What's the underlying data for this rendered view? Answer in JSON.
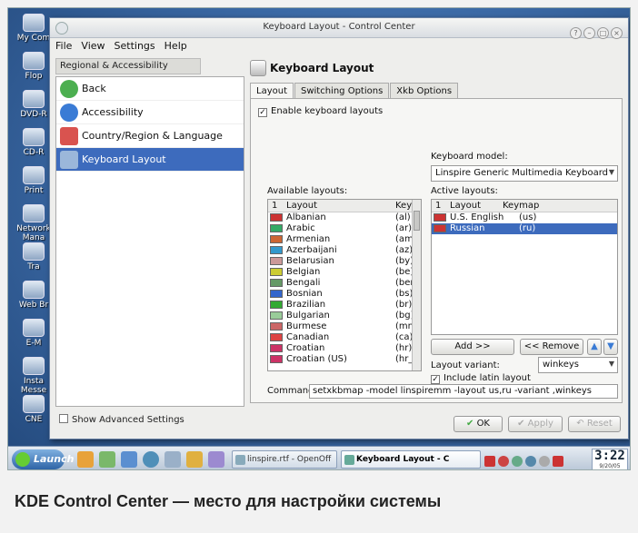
{
  "desktop": {
    "icons": [
      "My Com",
      "Flop",
      "DVD-R",
      "CD-R",
      "Print",
      "Network Mana",
      "Tra",
      "Web Br",
      "E-M",
      "Insta Messe",
      "CNE"
    ]
  },
  "window": {
    "title": "Keyboard Layout - Control Center",
    "menu": [
      "File",
      "View",
      "Settings",
      "Help"
    ]
  },
  "sidebar": {
    "header": "Regional & Accessibility",
    "items": [
      {
        "label": "Back",
        "color": "#4caf50"
      },
      {
        "label": "Accessibility",
        "color": "#3a7bd5"
      },
      {
        "label": "Country/Region & Language",
        "color": "#d9534f"
      },
      {
        "label": "Keyboard Layout",
        "color": "#9bb7da"
      }
    ],
    "advanced": "Show Advanced Settings"
  },
  "panel": {
    "title": "Keyboard Layout",
    "tabs": [
      "Layout",
      "Switching Options",
      "Xkb Options"
    ],
    "enable_label": "Enable keyboard layouts",
    "model_label": "Keyboard model:",
    "model_value": "Linspire Generic Multimedia Keyboard",
    "available_label": "Available layouts:",
    "active_label": "Active layouts:",
    "available_cols": [
      "1",
      "Layout",
      "Keyr"
    ],
    "active_cols": [
      "1",
      "Layout",
      "Keymap"
    ],
    "available": [
      {
        "name": "Albanian",
        "map": "(al)",
        "flag": "#c33"
      },
      {
        "name": "Arabic",
        "map": "(ar)",
        "flag": "#3a6"
      },
      {
        "name": "Armenian",
        "map": "(am)",
        "flag": "#c63"
      },
      {
        "name": "Azerbaijani",
        "map": "(az)",
        "flag": "#39c"
      },
      {
        "name": "Belarusian",
        "map": "(by)",
        "flag": "#c99"
      },
      {
        "name": "Belgian",
        "map": "(be)",
        "flag": "#cc3"
      },
      {
        "name": "Bengali",
        "map": "(ben)",
        "flag": "#696"
      },
      {
        "name": "Bosnian",
        "map": "(bs)",
        "flag": "#36c"
      },
      {
        "name": "Brazilian",
        "map": "(br)",
        "flag": "#3a3"
      },
      {
        "name": "Bulgarian",
        "map": "(bg)",
        "flag": "#9c9"
      },
      {
        "name": "Burmese",
        "map": "(mm)",
        "flag": "#c66"
      },
      {
        "name": "Canadian",
        "map": "(ca)",
        "flag": "#d44"
      },
      {
        "name": "Croatian",
        "map": "(hr)",
        "flag": "#c36"
      },
      {
        "name": "Croatian (US)",
        "map": "(hr_l",
        "flag": "#c36"
      }
    ],
    "active": [
      {
        "name": "U.S. English",
        "map": "(us)",
        "flag": "#c33"
      },
      {
        "name": "Russian",
        "map": "(ru)",
        "flag": "#c33"
      }
    ],
    "add_label": "Add >>",
    "remove_label": "<< Remove",
    "variant_label": "Layout variant:",
    "variant_value": "winkeys",
    "latin_label": "Include latin layout",
    "command_label": "Command:",
    "command_value": "setxkbmap -model linspiremm -layout us,ru -variant ,winkeys"
  },
  "dialog_buttons": {
    "ok": "OK",
    "apply": "Apply",
    "reset": "Reset"
  },
  "taskbar": {
    "launch": "Launch",
    "tasks": [
      "linspire.rtf - OpenOff",
      "Keyboard Layout - C"
    ],
    "time": "3:22",
    "date": "9/20/05"
  },
  "caption": "KDE Control Center — место для настройки системы"
}
